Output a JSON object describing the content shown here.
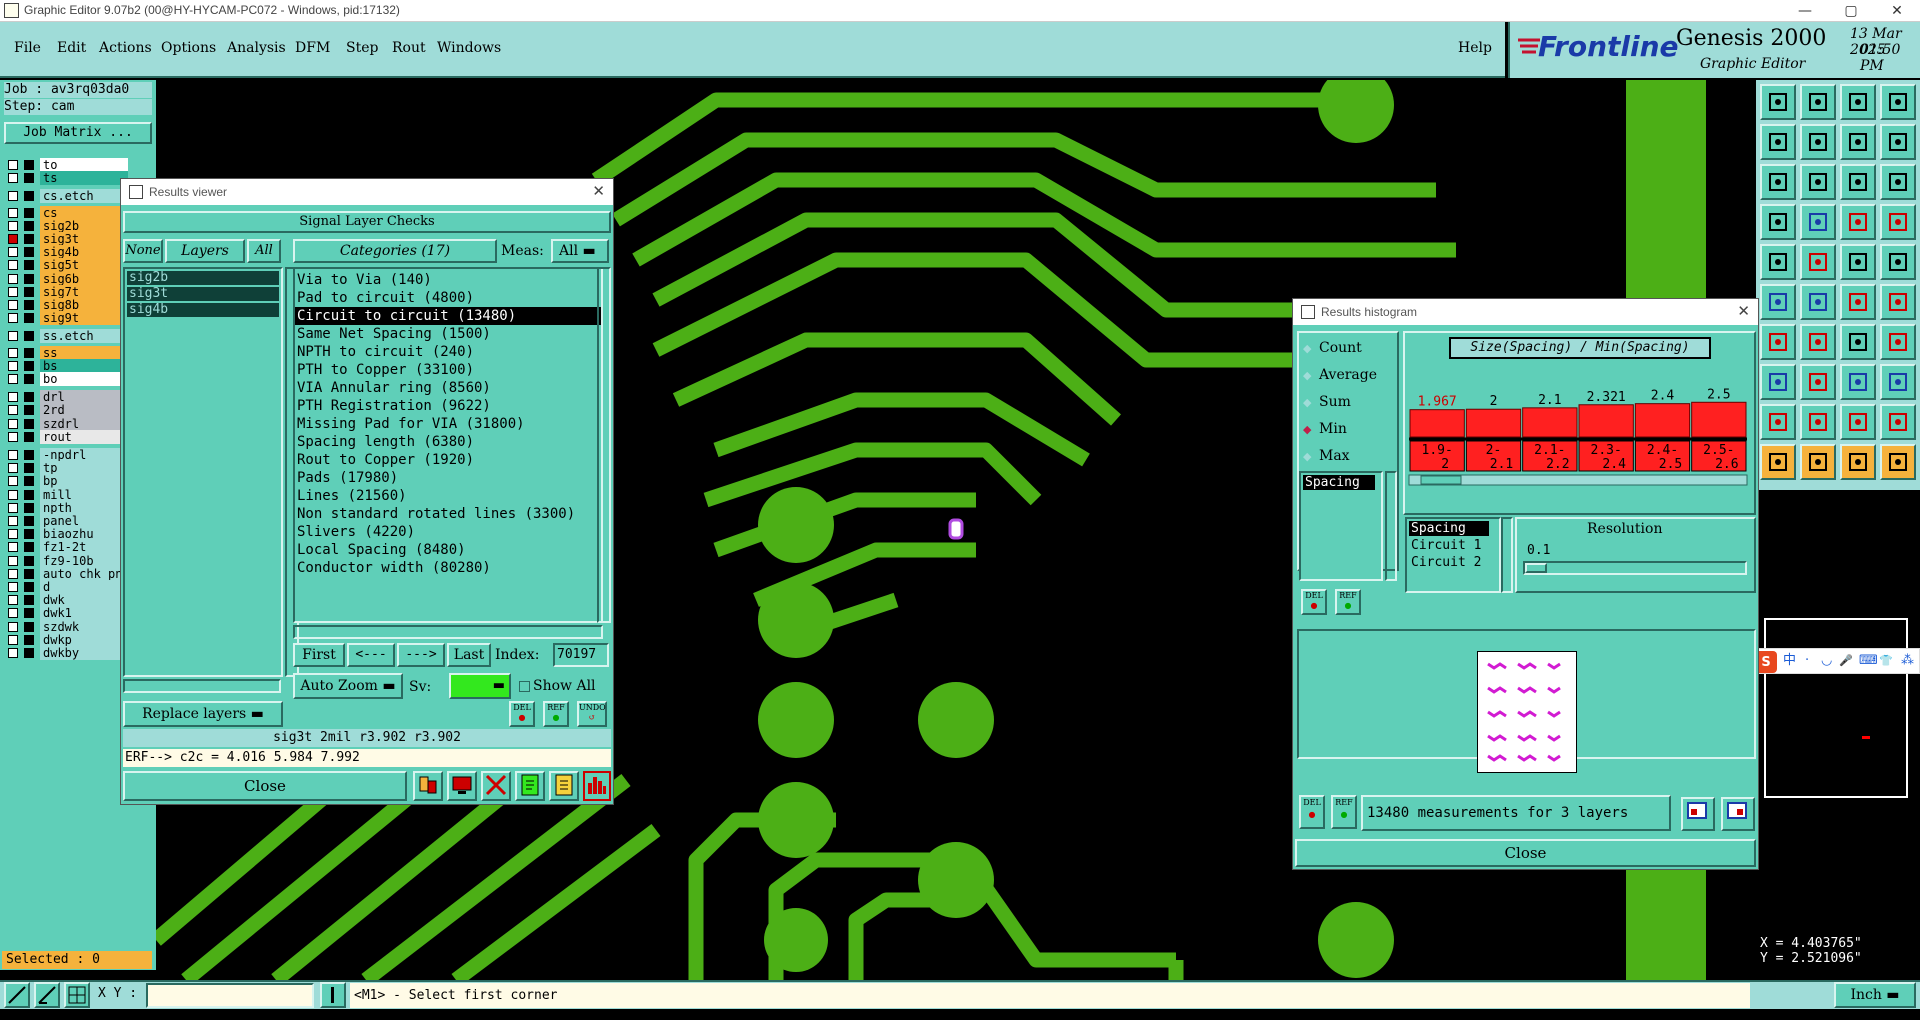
{
  "window": {
    "title": "Graphic Editor 9.07b2 (00@HY-HYCAM-PC072 - Windows, pid:17132)",
    "min": "—",
    "max": "▢",
    "close": "✕"
  },
  "menu": [
    "File",
    "Edit",
    "Actions",
    "Options",
    "Analysis",
    "DFM",
    "Step",
    "Rout",
    "Windows"
  ],
  "help": "Help",
  "brand": {
    "company": "Frontline",
    "product": "Genesis 2000",
    "sub": "Graphic Editor",
    "date": "13 Mar 2025",
    "time": "01:50 PM"
  },
  "job": {
    "job_label": "Job : av3rq03da0",
    "step_label": "Step: cam",
    "matrix_btn": "Job Matrix ..."
  },
  "layers": [
    {
      "name": "to",
      "color": "#ffffff",
      "checked": false
    },
    {
      "name": "ts",
      "color": "#2db39a",
      "checked": false
    },
    {
      "name": "cs.etch",
      "color": "#9fdcd8",
      "checked": false
    },
    {
      "name": "cs",
      "color": "#f5b23c",
      "checked": false
    },
    {
      "name": "sig2b",
      "color": "#f5b23c",
      "checked": false
    },
    {
      "name": "sig3t",
      "color": "#f5b23c",
      "checked": true
    },
    {
      "name": "sig4b",
      "color": "#f5b23c",
      "checked": false
    },
    {
      "name": "sig5t",
      "color": "#f5b23c",
      "checked": false
    },
    {
      "name": "sig6b",
      "color": "#f5b23c",
      "checked": false
    },
    {
      "name": "sig7t",
      "color": "#f5b23c",
      "checked": false
    },
    {
      "name": "sig8b",
      "color": "#f5b23c",
      "checked": false
    },
    {
      "name": "sig9t",
      "color": "#f5b23c",
      "checked": false
    },
    {
      "name": "ss.etch",
      "color": "#9fdcd8",
      "checked": false
    },
    {
      "name": "ss",
      "color": "#f5b23c",
      "checked": false
    },
    {
      "name": "bs",
      "color": "#2db39a",
      "checked": false
    },
    {
      "name": "bo",
      "color": "#ffffff",
      "checked": false
    },
    {
      "name": "drl",
      "color": "#b9bcc4",
      "checked": false
    },
    {
      "name": "2rd",
      "color": "#b9bcc4",
      "checked": false
    },
    {
      "name": "szdrl",
      "color": "#b9bcc4",
      "checked": false
    },
    {
      "name": "rout",
      "color": "#e8e8e8",
      "checked": false
    },
    {
      "name": "-npdrl",
      "color": "#9fdcd8",
      "checked": false
    },
    {
      "name": "tp",
      "color": "#9fdcd8",
      "checked": false
    },
    {
      "name": "bp",
      "color": "#9fdcd8",
      "checked": false
    },
    {
      "name": "mill",
      "color": "#9fdcd8",
      "checked": false
    },
    {
      "name": "npth",
      "color": "#9fdcd8",
      "checked": false
    },
    {
      "name": "panel",
      "color": "#9fdcd8",
      "checked": false
    },
    {
      "name": "biaozhu",
      "color": "#9fdcd8",
      "checked": false
    },
    {
      "name": "fz1-2t",
      "color": "#9fdcd8",
      "checked": false
    },
    {
      "name": "fz9-10b",
      "color": "#9fdcd8",
      "checked": false
    },
    {
      "name": "auto_chk_pn",
      "color": "#9fdcd8",
      "checked": false
    },
    {
      "name": "d",
      "color": "#9fdcd8",
      "checked": false
    },
    {
      "name": "dwk",
      "color": "#9fdcd8",
      "checked": false
    },
    {
      "name": "dwk1",
      "color": "#9fdcd8",
      "checked": false
    },
    {
      "name": "szdwk",
      "color": "#9fdcd8",
      "checked": false
    },
    {
      "name": "dwkp",
      "color": "#9fdcd8",
      "checked": false
    },
    {
      "name": "dwkby",
      "color": "#9fdcd8",
      "checked": false
    }
  ],
  "selected": "Selected : 0",
  "results_viewer": {
    "title": "Results viewer",
    "heading": "Signal Layer Checks",
    "none_btn": "None",
    "layers_btn": "Layers",
    "all_btn": "All",
    "categories_btn": "Categories (17)",
    "meas_label": "Meas:",
    "meas_value": "All",
    "layer_list": [
      "sig2b",
      "sig3t",
      "sig4b"
    ],
    "categories": [
      "Via to Via (140)",
      "Pad to circuit (4800)",
      "Circuit to circuit (13480)",
      "Same Net Spacing (1500)",
      "NPTH to circuit (240)",
      "PTH to Copper (33100)",
      "VIA Annular ring (8560)",
      "PTH Registration (9622)",
      "Missing Pad for VIA (31800)",
      "Spacing length (6380)",
      "Rout to Copper (1920)",
      "Pads (17980)",
      "Lines (21560)",
      "Non standard rotated lines (3300)",
      "Slivers (4220)",
      "Local Spacing (8480)",
      "Conductor width (80280)"
    ],
    "selected_category": 2,
    "first": "First",
    "prev": "<---",
    "next": "--->",
    "last": "Last",
    "index_label": "Index:",
    "index_value": "70197",
    "auto_zoom": "Auto Zoom",
    "sv_label": "Sv:",
    "show_all": "Show All",
    "replace_layers": "Replace layers",
    "del": "DEL",
    "ref": "REF",
    "undo": "UNDO",
    "info": "sig3t 2mil   r3.902   r3.902",
    "erf": "ERF--> c2c = 4.016 5.984 7.992",
    "close": "Close"
  },
  "histogram": {
    "title": "Results histogram",
    "options": [
      "Count",
      "Average",
      "Sum",
      "Min",
      "Max"
    ],
    "selected_option": 3,
    "chart_title": "Size(Spacing) / Min(Spacing)",
    "list": [
      "Spacing"
    ],
    "metrics": [
      "Spacing",
      "Circuit 1",
      "Circuit 2"
    ],
    "resolution_label": "Resolution",
    "resolution_value": "0.1",
    "del": "DEL",
    "ref": "REF",
    "summary": "13480 measurements for 3 layers",
    "close": "Close"
  },
  "chart_data": {
    "type": "bar",
    "title": "Size(Spacing) / Min(Spacing)",
    "categories": [
      "1.9-2",
      "2-2.1",
      "2.1-2.2",
      "2.3-2.4",
      "2.4-2.5",
      "2.5-2.6"
    ],
    "values": [
      1.967,
      2,
      2.1,
      2.321,
      2.4,
      2.5
    ],
    "value_labels": [
      "1.967",
      "2",
      "2.1",
      "2.321",
      "2.4",
      "2.5"
    ],
    "color": "#ff2020"
  },
  "coords": {
    "x": "X = 4.403765\"",
    "y": "Y = 2.521096\""
  },
  "status": {
    "xy_label": "X Y :",
    "prompt": "<M1> - Select first corner",
    "units": "Inch"
  },
  "ime": [
    "中",
    "·",
    "◡",
    "🎤",
    "⌨",
    "👕",
    "⁂"
  ],
  "colors": {
    "background": "#5fcfb8",
    "copper": "#4caf16",
    "canvas": "#000000",
    "bar": "#ff2020"
  }
}
